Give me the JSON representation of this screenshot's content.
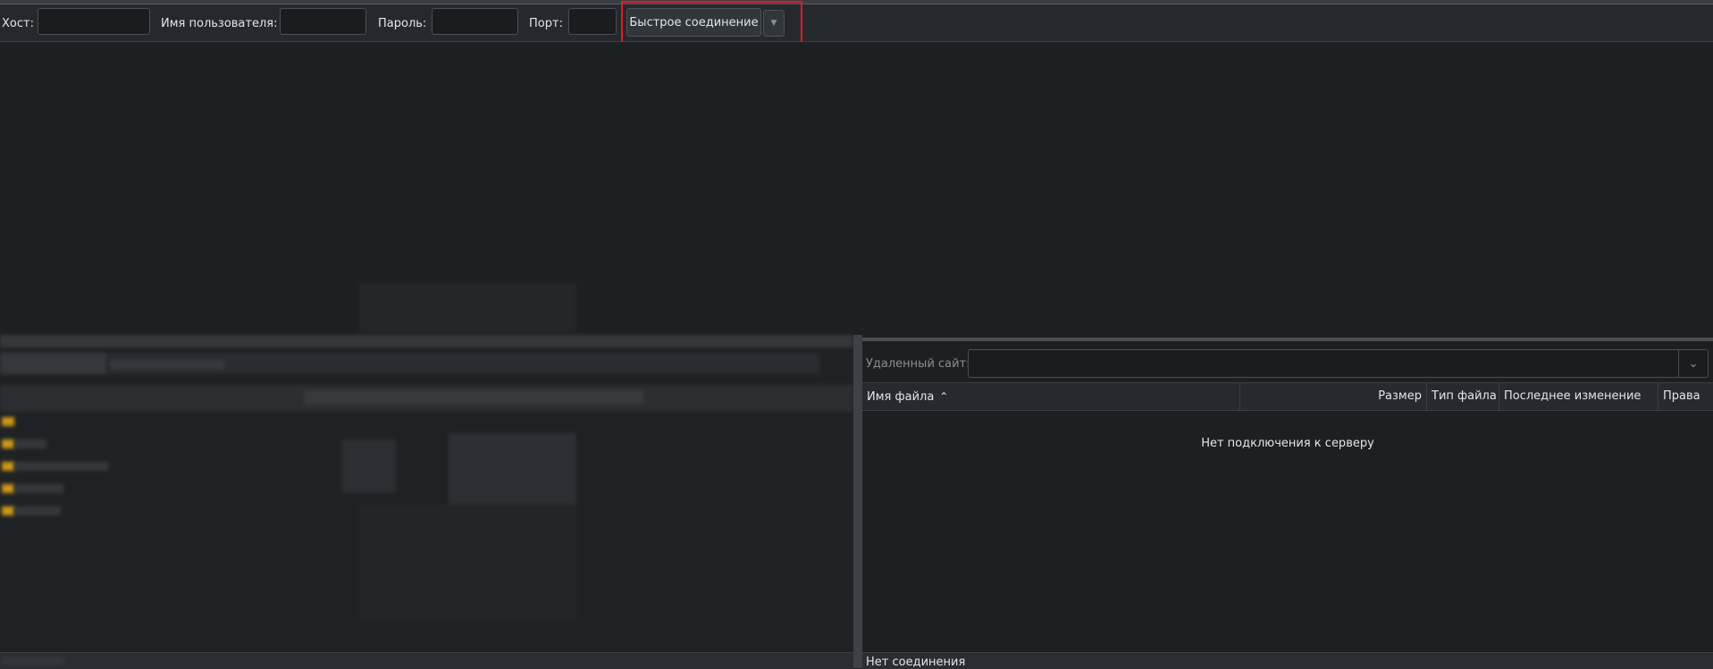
{
  "quickconnect": {
    "host_label": "Хост:",
    "host_value": "",
    "username_label": "Имя пользователя:",
    "username_value": "",
    "password_label": "Пароль:",
    "password_value": "",
    "port_label": "Порт:",
    "port_value": "",
    "connect_button": "Быстрое соединение",
    "dropdown_icon": "chevron-down-icon"
  },
  "remote": {
    "site_label": "Удаленный сайт:",
    "site_value": "",
    "columns": [
      "Имя файла",
      "Размер",
      "Тип файла",
      "Последнее изменение",
      "Права"
    ],
    "sort_icon": "chevron-up-icon",
    "empty_message": "Нет подключения к серверу"
  },
  "status": {
    "remote_status": "Нет соединения"
  },
  "colors": {
    "background": "#1d2023",
    "highlight": "#e31b23",
    "folder": "#e0a416"
  }
}
